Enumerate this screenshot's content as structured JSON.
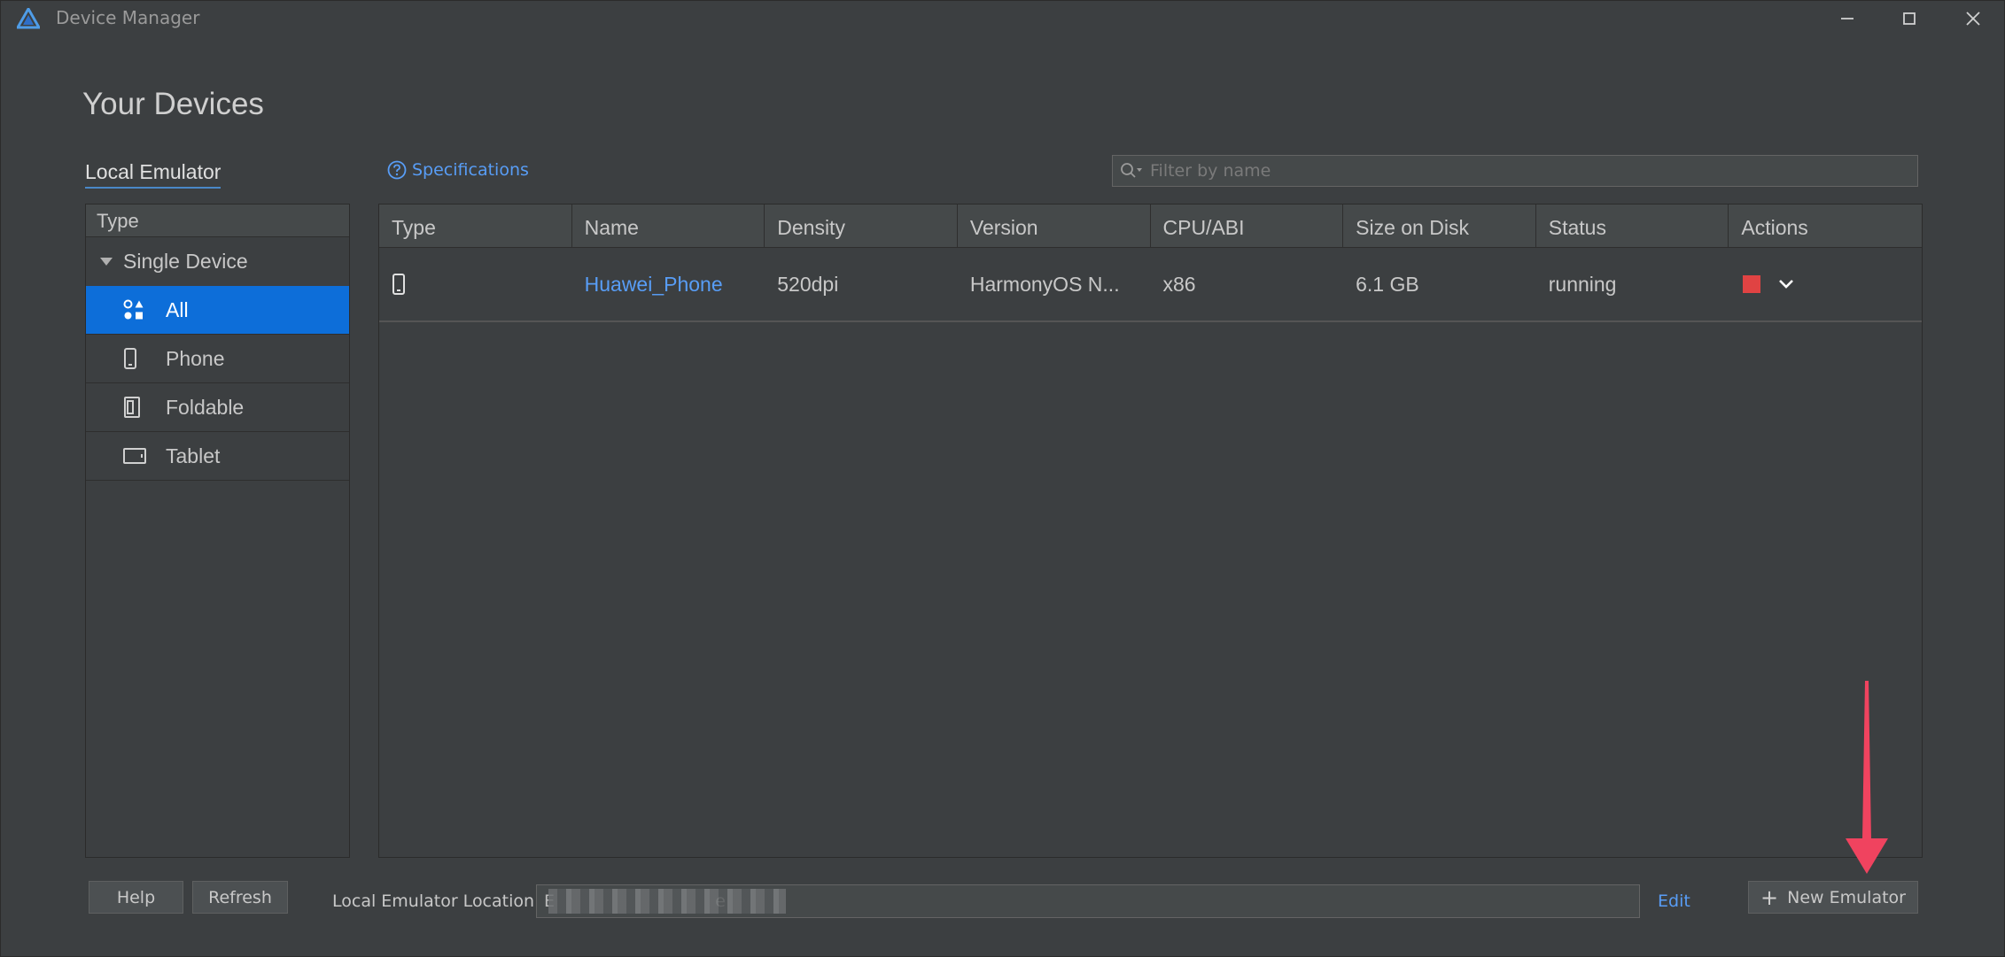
{
  "window": {
    "title": "Device Manager"
  },
  "heading": "Your Devices",
  "tab": "Local Emulator",
  "specifications": "Specifications",
  "search": {
    "placeholder": "Filter by name"
  },
  "sidebar": {
    "header": "Type",
    "group": "Single Device",
    "items": [
      {
        "label": "All",
        "icon": "all-devices-icon",
        "active": true
      },
      {
        "label": "Phone",
        "icon": "phone-icon",
        "active": false
      },
      {
        "label": "Foldable",
        "icon": "foldable-icon",
        "active": false
      },
      {
        "label": "Tablet",
        "icon": "tablet-icon",
        "active": false
      }
    ]
  },
  "table": {
    "columns": [
      "Type",
      "Name",
      "Density",
      "Version",
      "CPU/ABI",
      "Size on Disk",
      "Status",
      "Actions"
    ],
    "rows": [
      {
        "type_icon": "phone-icon",
        "name": "Huawei_Phone",
        "density": "520dpi",
        "version": "HarmonyOS N...",
        "cpu": "x86",
        "size": "6.1 GB",
        "status": "running",
        "actions": [
          "stop-icon",
          "chevron-down-icon"
        ]
      }
    ]
  },
  "footer": {
    "help": "Help",
    "refresh": "Refresh",
    "location_label": "Local Emulator Location:",
    "location_value": "E                              e",
    "edit": "Edit",
    "new_emulator": "New Emulator"
  },
  "colors": {
    "background": "#3c3f41",
    "accent": "#0d6ed9",
    "link": "#589df6",
    "stop": "#e04343",
    "annotation_arrow": "#f0435f"
  }
}
